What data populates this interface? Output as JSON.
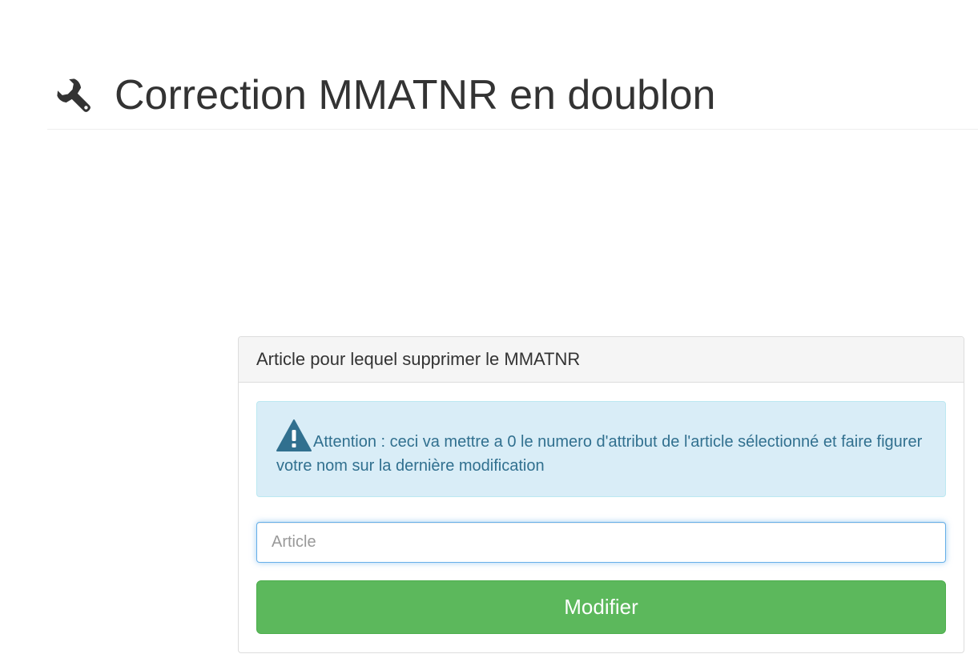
{
  "header": {
    "title": "Correction MMATNR en doublon",
    "icon": "wrench-icon"
  },
  "panel": {
    "heading": "Article pour lequel supprimer le MMATNR",
    "alert": {
      "icon": "warning-icon",
      "text": "Attention : ceci va mettre a 0 le numero d'attribut de l'article sélectionné et faire figurer votre nom sur la dernière modification"
    },
    "article_input": {
      "value": "",
      "placeholder": "Article"
    },
    "submit_label": "Modifier"
  },
  "colors": {
    "alert_bg": "#d9edf7",
    "alert_text": "#31708f",
    "button_bg": "#5cb85c",
    "focus_border": "#66afe9"
  }
}
